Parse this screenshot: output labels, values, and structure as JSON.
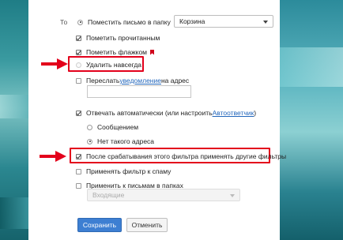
{
  "filter": {
    "to_label": "То",
    "move_to_folder": {
      "label": "Поместить письмо в папку",
      "checked": true,
      "folder_value": "Корзина"
    },
    "mark_read": {
      "label": "Пометить прочитанным",
      "checked": true
    },
    "mark_flag": {
      "label": "Пометить флажком",
      "checked": true,
      "flag_icon": "red-flag-icon"
    },
    "delete_forever": {
      "label": "Удалить навсегда",
      "selected": false
    },
    "forward": {
      "label_prefix": "Переслать ",
      "link": "уведомление",
      "label_suffix": " на адрес",
      "checked": false,
      "address_value": ""
    },
    "auto_reply": {
      "label_prefix": "Отвечать автоматически (или настроить ",
      "link": "Автоответчик",
      "label_suffix": ")",
      "checked": true
    },
    "reply_message": {
      "label": "Сообщением",
      "selected": false
    },
    "reply_no_address": {
      "label": "Нет такого адреса",
      "selected": true
    },
    "after_filter": {
      "label": "После срабатывания этого фильтра применять другие фильтры",
      "checked": true
    },
    "apply_spam": {
      "label": "Применять фильтр к спаму",
      "checked": false
    },
    "apply_folders": {
      "label": "Применить к письмам в папках",
      "checked": false,
      "folder_placeholder": "Входящие"
    }
  },
  "buttons": {
    "save": "Сохранить",
    "cancel": "Отменить"
  },
  "colors": {
    "highlight": "#e3001b",
    "arrow": "#e3001b",
    "primary": "#3d7fd2",
    "link": "#2266bb",
    "flag": "#d0021b"
  }
}
